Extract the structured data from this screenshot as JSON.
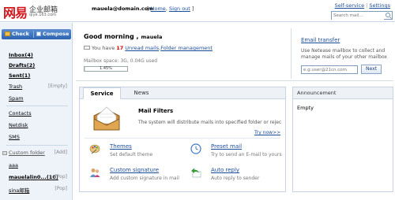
{
  "header": {
    "logo_main": "网易",
    "logo_sub": "企业邮箱",
    "logo_domain": "qiye.163.com",
    "user_email": "mauela@domain.com",
    "links_open": "[ ",
    "home_link": "Home",
    "link_sep": ", ",
    "signout_link": "Sign out",
    "links_close": " ]",
    "self_service": "Self-service",
    "settings": "Settings",
    "search_placeholder": "Search mail..."
  },
  "sidebar": {
    "check_label": "Check",
    "compose_label": "Compose",
    "items": [
      {
        "label": "Inbox(4)",
        "bold": true
      },
      {
        "label": "Drafts(2)",
        "bold": true
      },
      {
        "label": "Sent(1)",
        "bold": true
      },
      {
        "label": "Trash",
        "extra": "[Empty]"
      },
      {
        "label": "Spam"
      },
      {
        "label": "Contacts"
      },
      {
        "label": "Netdisk"
      },
      {
        "label": "SMS"
      },
      {
        "label": "Custom folder",
        "extra": "[Add]"
      },
      {
        "label": "aaa"
      },
      {
        "label": "mauelalin0...(10)",
        "extra": "[Pop]",
        "bold": true
      },
      {
        "label": "sina邮箱",
        "extra": "[Pop]"
      }
    ]
  },
  "main": {
    "greeting": "Good morning ,",
    "greeting_name": "mauela",
    "unread_prefix": "You have",
    "unread_count": "17",
    "unread_link": "Unread mails",
    "unread_sep": ",",
    "folder_mgmt": "Folder management",
    "mailbox_space": "Mailbox space: 3G, 0.04G used",
    "usage_percent": "1.45%",
    "usage_fraction": 0.0145
  },
  "email_transfer": {
    "title": "Email transfer",
    "description": "Use Netease mailbox to collect and manage mails of your other mailbox",
    "input_placeholder": "e.g:user@21cn.com",
    "next_label": "Next"
  },
  "service_panel": {
    "tab_service": "Service",
    "tab_news": "News",
    "mail_filters_title": "Mail Filters",
    "mail_filters_desc": "The system will distribute mails into specified folder or rejec",
    "try_now": "Try now>>",
    "themes_title": "Themes",
    "themes_desc": "Set default theme",
    "preset_title": "Preset mail",
    "preset_desc": "Try to send an E-mail to yours",
    "signature_title": "Custom signature",
    "signature_desc": "Add custom signature in mail",
    "autoreply_title": "Auto reply",
    "autoreply_desc": "Auto reply to sender"
  },
  "announcement": {
    "title": "Announcement",
    "body": "Empty"
  }
}
